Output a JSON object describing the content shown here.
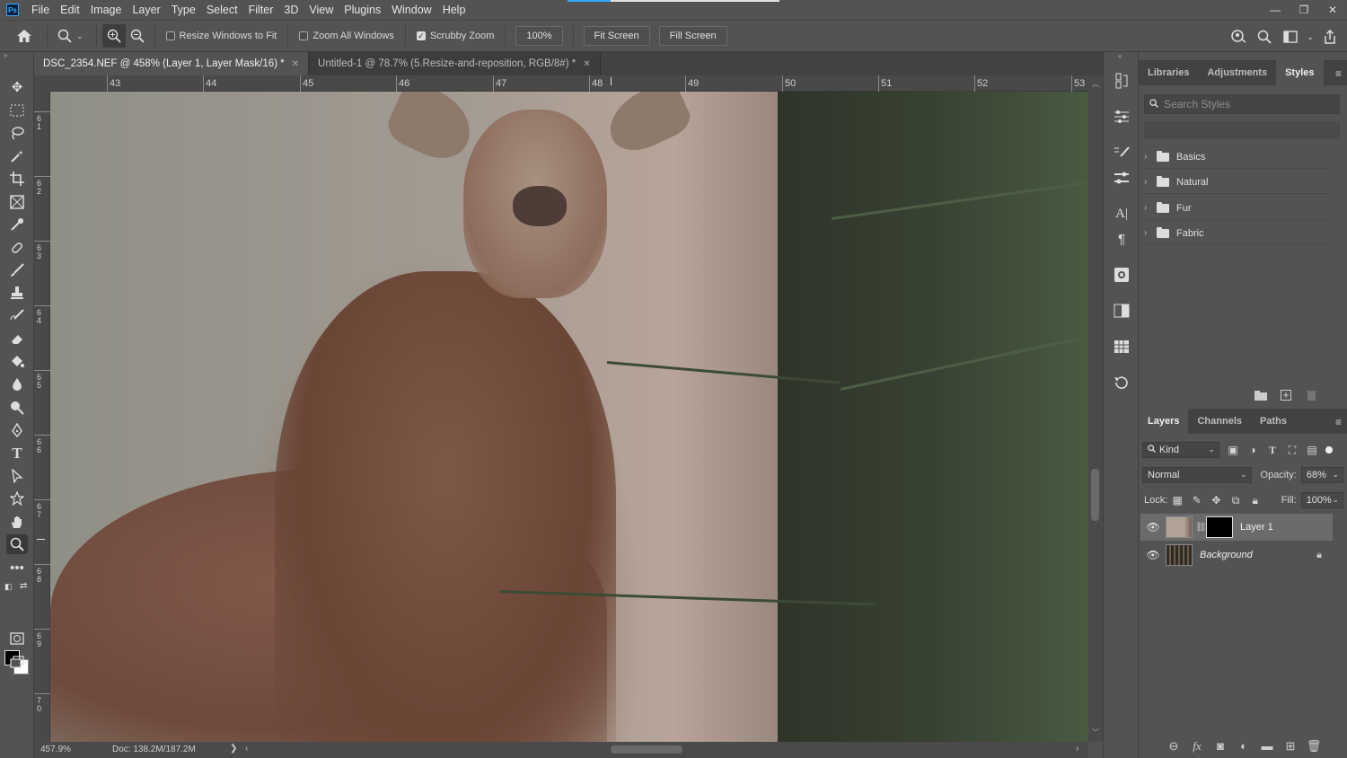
{
  "app": {
    "logo": "Ps"
  },
  "menu": [
    "File",
    "Edit",
    "Image",
    "Layer",
    "Type",
    "Select",
    "Filter",
    "3D",
    "View",
    "Plugins",
    "Window",
    "Help"
  ],
  "window_controls": {
    "minimize": "—",
    "restore": "❐",
    "close": "✕"
  },
  "options_bar": {
    "resize_windows_label": "Resize Windows to Fit",
    "resize_windows_checked": false,
    "zoom_all_label": "Zoom All Windows",
    "zoom_all_checked": false,
    "scrubby_zoom_label": "Scrubby Zoom",
    "scrubby_zoom_checked": true,
    "zoom_value": "100%",
    "fit_screen_label": "Fit Screen",
    "fill_screen_label": "Fill Screen"
  },
  "tabs": [
    {
      "label": "DSC_2354.NEF @ 458% (Layer 1, Layer Mask/16) *",
      "active": true
    },
    {
      "label": "Untitled-1 @ 78.7% (5.Resize-and-reposition, RGB/8#) *",
      "active": false
    }
  ],
  "ruler_top": [
    "43",
    "44",
    "45",
    "46",
    "47",
    "48",
    "49",
    "50",
    "51",
    "52",
    "53"
  ],
  "ruler_left": [
    "6\n1",
    "6\n2",
    "6\n3",
    "6\n4",
    "6\n5",
    "6\n6",
    "6\n7",
    "6\n8",
    "6\n9",
    "7\n0"
  ],
  "status": {
    "zoom": "457.9%",
    "doc": "Doc: 138.2M/187.2M",
    "arrow": "❯"
  },
  "styles_panel": {
    "tabs": [
      "Libraries",
      "Adjustments",
      "Styles"
    ],
    "active_tab": "Styles",
    "search_placeholder": "Search Styles",
    "folders": [
      "Basics",
      "Natural",
      "Fur",
      "Fabric"
    ]
  },
  "layers_panel": {
    "tabs": [
      "Layers",
      "Channels",
      "Paths"
    ],
    "active_tab": "Layers",
    "kind_label": "Kind",
    "blend_mode": "Normal",
    "opacity_label": "Opacity:",
    "opacity_value": "68%",
    "lock_label": "Lock:",
    "fill_label": "Fill:",
    "fill_value": "100%",
    "layers": [
      {
        "name": "Layer 1",
        "selected": true,
        "has_mask": true,
        "locked": false
      },
      {
        "name": "Background",
        "selected": false,
        "has_mask": false,
        "locked": true
      }
    ]
  },
  "colors": {
    "ui_bg": "#535353",
    "accent": "#31a8ff",
    "foreground_swatch": "#000000",
    "background_swatch": "#ffffff"
  }
}
